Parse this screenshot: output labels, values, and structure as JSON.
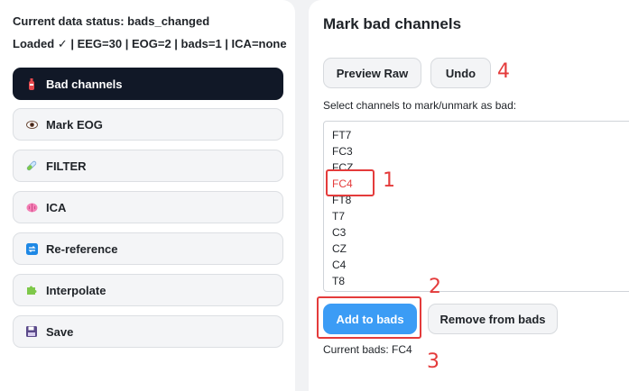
{
  "sidebar": {
    "status_line1": "Current data status: bads_changed",
    "status_line2": "Loaded ✓ | EEG=30 | EOG=2 | bads=1 | ICA=none",
    "items": [
      {
        "label": "Bad channels",
        "icon": "fire-extinguisher-icon",
        "active": true
      },
      {
        "label": "Mark EOG",
        "icon": "eye-icon",
        "active": false
      },
      {
        "label": "FILTER",
        "icon": "test-tube-icon",
        "active": false
      },
      {
        "label": "ICA",
        "icon": "brain-icon",
        "active": false
      },
      {
        "label": "Re-reference",
        "icon": "repeat-icon",
        "active": false
      },
      {
        "label": "Interpolate",
        "icon": "puzzle-icon",
        "active": false
      },
      {
        "label": "Save",
        "icon": "floppy-disk-icon",
        "active": false
      }
    ]
  },
  "main": {
    "title": "Mark bad channels",
    "preview_raw_label": "Preview Raw",
    "undo_label": "Undo",
    "select_label": "Select channels to mark/unmark as bad:",
    "channels": [
      "FT7",
      "FC3",
      "FCZ",
      "FC4",
      "FT8",
      "T7",
      "C3",
      "CZ",
      "C4",
      "T8"
    ],
    "highlighted_channel": "FC4",
    "add_label": "Add to bads",
    "remove_label": "Remove from bads",
    "current_bads": "Current bads: FC4"
  },
  "annotations": [
    "1",
    "2",
    "3",
    "4"
  ],
  "colors": {
    "active_nav_bg": "#111827",
    "primary_button": "#3b9cf5",
    "annotation_red": "#e43b3b",
    "highlight_text": "#e43b3b"
  }
}
